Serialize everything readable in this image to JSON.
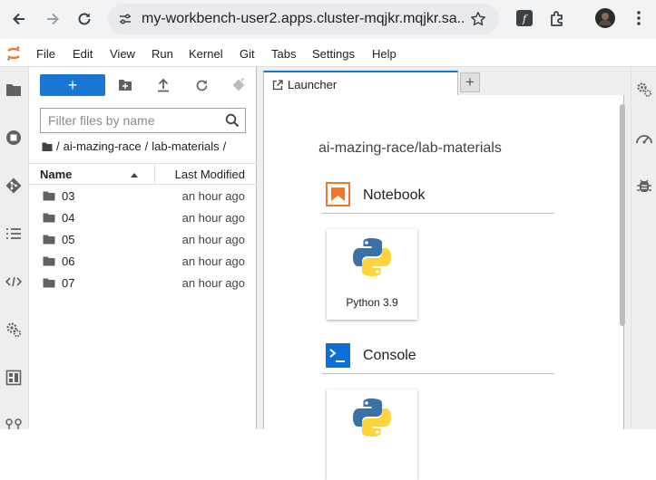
{
  "browser": {
    "url": "my-workbench-user2.apps.cluster-mqjkr.mqjkr.sa..."
  },
  "menubar": {
    "items": [
      "File",
      "Edit",
      "View",
      "Run",
      "Kernel",
      "Git",
      "Tabs",
      "Settings",
      "Help"
    ]
  },
  "filebrowser": {
    "new_label": "+",
    "filter_placeholder": "Filter files by name",
    "breadcrumb": {
      "sep0": "/",
      "part1": "ai-mazing-race",
      "sep1": "/",
      "part2": "lab-materials",
      "sep2": "/"
    },
    "columns": {
      "name": "Name",
      "modified": "Last Modified"
    },
    "rows": [
      {
        "name": "03",
        "modified": "an hour ago"
      },
      {
        "name": "04",
        "modified": "an hour ago"
      },
      {
        "name": "05",
        "modified": "an hour ago"
      },
      {
        "name": "06",
        "modified": "an hour ago"
      },
      {
        "name": "07",
        "modified": "an hour ago"
      }
    ]
  },
  "tabs": {
    "launcher_label": "Launcher",
    "add_label": "+"
  },
  "launcher": {
    "cwd": "ai-mazing-race/lab-materials",
    "notebook_section": "Notebook",
    "notebook_card": "Python 3.9",
    "console_section": "Console"
  },
  "colors": {
    "accent": "#1976d2",
    "notebook_orange": "#f37726",
    "console_blue": "#0d6fd6",
    "python_blue": "#3a72a6",
    "python_yellow": "#ffd43b"
  }
}
